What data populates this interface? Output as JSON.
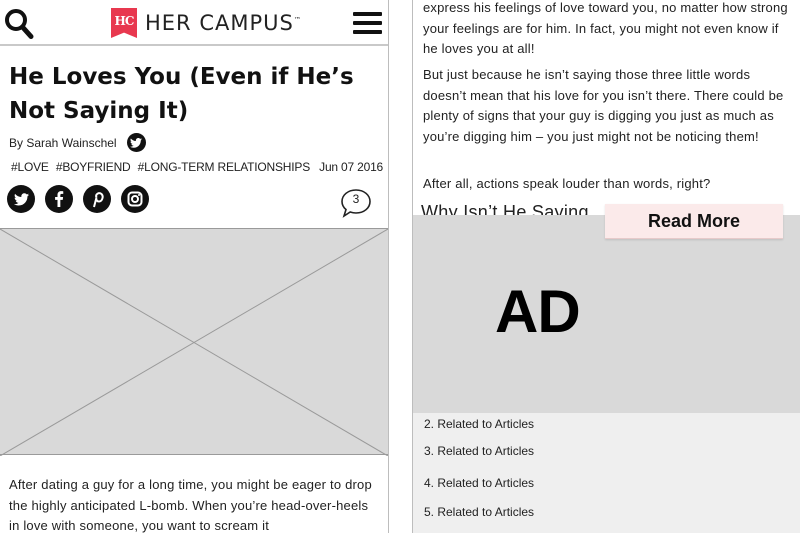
{
  "header": {
    "logo_mark": "HC",
    "brand": "HER CAMPUS",
    "brand_tm": "™"
  },
  "article": {
    "title": "He Loves You (Even if He’s Not Saying It)",
    "byline": "By Sarah Wainschel",
    "tags": [
      "#LOVE",
      "#BOYFRIEND",
      "#LONG-TERM RELATIONSHIPS"
    ],
    "date": "Jun 07 2016",
    "comment_count": "3",
    "social_icons": [
      "twitter-icon",
      "facebook-icon",
      "pinterest-icon",
      "instagram-icon"
    ],
    "intro": "After dating a guy for a long time, you might be eager to drop the highly anticipated L-bomb. When you’re head-over-heels in love with someone, you want to scream it"
  },
  "right_panel": {
    "para1": "express his feelings of love toward you, no matter how strong your feelings are for him. In fact, you might not even know if he loves you at all!",
    "para2": "But just because he isn’t saying those three little words doesn’t mean that his love for you isn’t there. There could be plenty of signs that your guy is digging you just as much as you’re digging him – you just might not be noticing them!",
    "para3": "After all, actions speak louder than words, right?",
    "subhead_partial": "Why Isn’t He Saying",
    "read_more": "Read More",
    "ad_label": "AD",
    "related": [
      "2. Related to Articles",
      "3. Related to Articles",
      "4. Related to Articles",
      "5. Related to Articles"
    ]
  },
  "colors": {
    "brand": "#e8384f",
    "placeholder": "#d9d9d9",
    "read_more_bg": "#fbeaea",
    "related_bg": "#efefef"
  }
}
